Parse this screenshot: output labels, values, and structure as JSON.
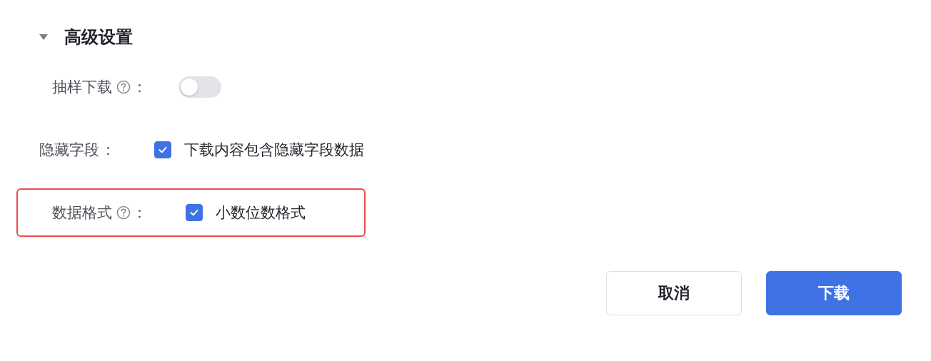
{
  "section": {
    "title": "高级设置",
    "expanded": true
  },
  "fields": [
    {
      "label": "抽样下载",
      "help": true,
      "kind": "toggle",
      "on": false,
      "highlighted": false
    },
    {
      "label": "隐藏字段",
      "help": false,
      "kind": "checkbox",
      "checked": true,
      "option": "下载内容包含隐藏字段数据",
      "highlighted": false
    },
    {
      "label": "数据格式",
      "help": true,
      "kind": "checkbox",
      "checked": true,
      "option": "小数位数格式",
      "highlighted": true
    }
  ],
  "colon": "：",
  "buttons": [
    {
      "label": "取消",
      "kind": "secondary"
    },
    {
      "label": "下载",
      "kind": "primary"
    }
  ]
}
